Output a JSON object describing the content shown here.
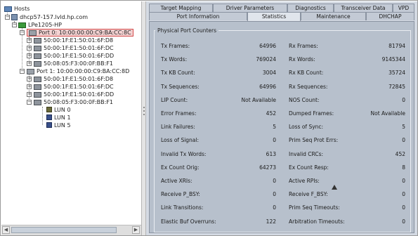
{
  "tree": {
    "root_label": "Hosts",
    "host_label": "dhcp57-157.lvld.hp.com",
    "hba_label": "LPe1205-HP",
    "port0_label": "Port 0: 10:00:00:00:C9:BA:CC:8C",
    "port0_targets": [
      "50:00:1F:E1:50:01:6F:D8",
      "50:00:1F:E1:50:01:6F:DC",
      "50:00:1F:E1:50:01:6F:DD",
      "50:08:05:F3:00:0F:BB:F1"
    ],
    "port1_label": "Port 1: 10:00:00:00:C9:BA:CC:8D",
    "port1_targets": [
      "50:00:1F:E1:50:01:6F:D8",
      "50:00:1F:E1:50:01:6F:DC",
      "50:00:1F:E1:50:01:6F:DD",
      "50:08:05:F3:00:0F:BB:F1"
    ],
    "luns": [
      "LUN   0",
      "LUN   1",
      "LUN   5"
    ]
  },
  "tabs": {
    "row1": [
      "Target Mapping",
      "Driver Parameters",
      "Diagnostics",
      "Transceiver Data",
      "VPD"
    ],
    "row2": [
      "Port Information",
      "Statistics",
      "Maintenance",
      "DHCHAP"
    ],
    "active": "Statistics"
  },
  "group_title": "Physical Port Counters",
  "counters": [
    {
      "l_label": "Tx Frames:",
      "l_value": "64996",
      "r_label": "Rx Frames:",
      "r_value": "81794"
    },
    {
      "l_label": "Tx Words:",
      "l_value": "769024",
      "r_label": "Rx Words:",
      "r_value": "9145344"
    },
    {
      "l_label": "Tx KB Count:",
      "l_value": "3004",
      "r_label": "Rx KB Count:",
      "r_value": "35724"
    },
    {
      "l_label": "Tx Sequences:",
      "l_value": "64996",
      "r_label": "Rx Sequences:",
      "r_value": "72845"
    },
    {
      "l_label": "LIP Count:",
      "l_value": "Not Available",
      "r_label": "NOS Count:",
      "r_value": "0"
    },
    {
      "l_label": "Error Frames:",
      "l_value": "452",
      "r_label": "Dumped Frames:",
      "r_value": "Not Available"
    },
    {
      "l_label": "Link Failures:",
      "l_value": "5",
      "r_label": "Loss of Sync:",
      "r_value": "5"
    },
    {
      "l_label": "Loss of Signal:",
      "l_value": "0",
      "r_label": "Prim Seq Prot Errs:",
      "r_value": "0"
    },
    {
      "l_label": "Invalid Tx Words:",
      "l_value": "613",
      "r_label": "Invalid CRCs:",
      "r_value": "452"
    },
    {
      "l_label": "Ex Count Orig:",
      "l_value": "64273",
      "r_label": "Ex Count Resp:",
      "r_value": "8"
    },
    {
      "l_label": "Active XRIs:",
      "l_value": "0",
      "r_label": "Active RPIs:",
      "r_value": "0"
    },
    {
      "l_label": "Receive P_BSY:",
      "l_value": "0",
      "r_label": "Receive F_BSY:",
      "r_value": "0"
    },
    {
      "l_label": "Link Transitions:",
      "l_value": "0",
      "r_label": "Prim Seq Timeouts:",
      "r_value": "0"
    },
    {
      "l_label": "Elastic Buf Overruns:",
      "l_value": "122",
      "r_label": "Arbitration Timeouts:",
      "r_value": "0"
    }
  ]
}
